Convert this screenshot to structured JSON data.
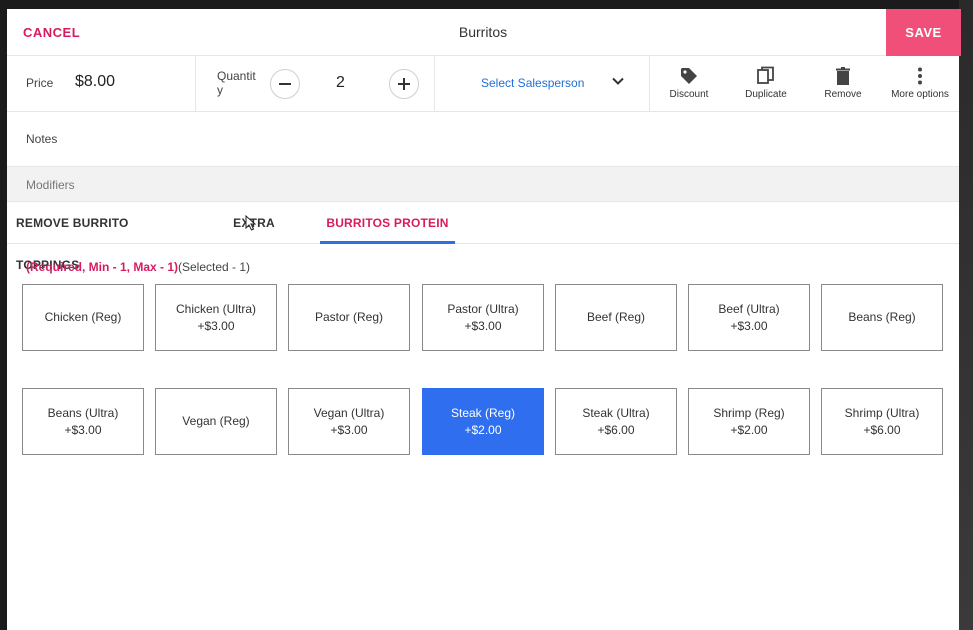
{
  "header": {
    "cancel_label": "CANCEL",
    "title": "Burritos",
    "save_label": "SAVE"
  },
  "item": {
    "price_label": "Price",
    "price_value": "$8.00",
    "quantity_label": "Quantit y",
    "quantity_value": "2",
    "salesperson_label": "Select Salesperson"
  },
  "toolbar": {
    "discount_label": "Discount",
    "duplicate_label": "Duplicate",
    "remove_label": "Remove",
    "more_label": "More options"
  },
  "notes": {
    "label": "Notes"
  },
  "modifiers": {
    "header": "Modifiers",
    "tabs": [
      {
        "label": "REMOVE BURRITO TOPPINGS"
      },
      {
        "label": "EXTRA"
      },
      {
        "label": "BURRITOS PROTEIN"
      }
    ],
    "requirement": "(Required, Min - 1, Max - 1)",
    "selected_count": "(Selected - 1)",
    "options": [
      {
        "name": "Chicken (Reg)",
        "price": ""
      },
      {
        "name": "Chicken (Ultra)",
        "price": "+$3.00"
      },
      {
        "name": "Pastor (Reg)",
        "price": ""
      },
      {
        "name": "Pastor (Ultra)",
        "price": "+$3.00"
      },
      {
        "name": "Beef (Reg)",
        "price": ""
      },
      {
        "name": "Beef (Ultra)",
        "price": "+$3.00"
      },
      {
        "name": "Beans (Reg)",
        "price": ""
      },
      {
        "name": "Beans (Ultra)",
        "price": "+$3.00"
      },
      {
        "name": "Vegan (Reg)",
        "price": ""
      },
      {
        "name": "Vegan (Ultra)",
        "price": "+$3.00"
      },
      {
        "name": "Steak (Reg)",
        "price": "+$2.00",
        "selected": true
      },
      {
        "name": "Steak (Ultra)",
        "price": "+$6.00"
      },
      {
        "name": "Shrimp (Reg)",
        "price": "+$2.00"
      },
      {
        "name": "Shrimp (Ultra)",
        "price": "+$6.00"
      }
    ]
  },
  "colors": {
    "accent_pink": "#d81b60",
    "save_bg": "#ef4f79",
    "selected_blue": "#2f6fef",
    "link_blue": "#1e6fd9"
  }
}
